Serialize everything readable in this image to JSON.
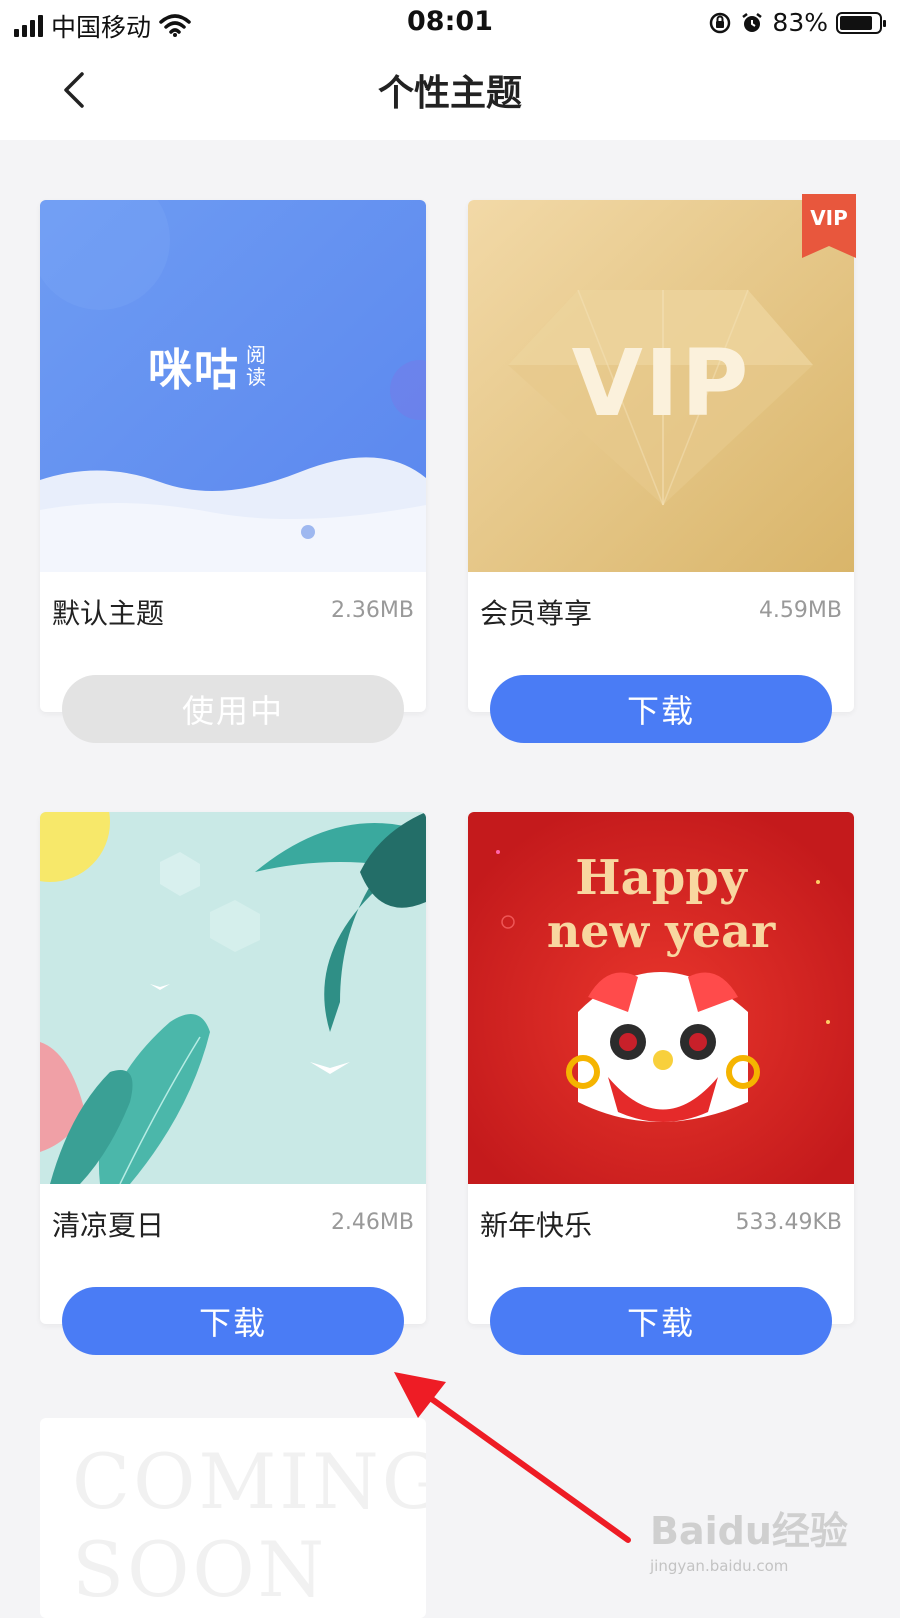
{
  "status_bar": {
    "carrier": "中国移动",
    "time": "08:01",
    "battery": "83%"
  },
  "nav": {
    "title": "个性主题"
  },
  "themes": [
    {
      "name": "默认主题",
      "size": "2.36MB",
      "action": "使用中",
      "logo_text": "咪咕",
      "logo_sub": "阅读"
    },
    {
      "name": "会员尊享",
      "size": "4.59MB",
      "action": "下载",
      "art_text": "VIP",
      "badge": "VIP"
    },
    {
      "name": "清凉夏日",
      "size": "2.46MB",
      "action": "下载"
    },
    {
      "name": "新年快乐",
      "size": "533.49KB",
      "action": "下载",
      "art_line1": "Happy",
      "art_line2": "new year"
    }
  ],
  "coming_soon": {
    "line1": "COMING",
    "line2": "SOON"
  },
  "watermark": {
    "brand": "Baidu经验",
    "url": "jingyan.baidu.com"
  },
  "colors": {
    "accent": "#4a7cf5",
    "in_use": "#e3e3e3",
    "background": "#f4f4f6"
  }
}
